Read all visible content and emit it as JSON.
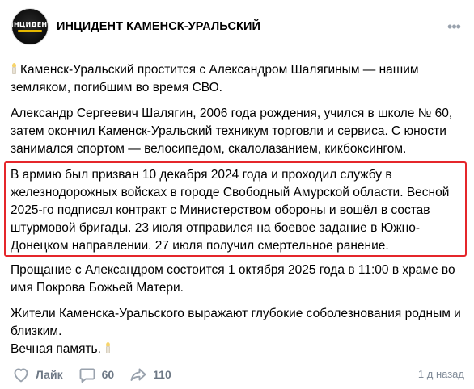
{
  "header": {
    "avatar_text": "ИНЦИДЕНТ",
    "title": "ИНЦИДЕНТ КАМЕНСК-УРАЛЬСКИЙ",
    "more_icon": "dots-horizontal-icon"
  },
  "post": {
    "p1": "Каменск-Уральский простится с Александром Шалягиным — нашим земляком, погибшим во время СВО.",
    "p2": "Александр Сергеевич Шалягин, 2006 года рождения, учился в школе № 60, затем окончил Каменск-Уральский техникум торговли и сервиса. С юности занимался спортом — велосипедом, скалолазанием, кикбоксингом.",
    "p3": "В армию был призван 10 декабря 2024 года и проходил службу в железнодорожных войсках в городе Свободный Амурской области. Весной 2025-го подписал контракт с Министерством обороны и вошёл в состав штурмовой бригады. 23 июля отправился на боевое задание в Южно-Донецком направлении. 27 июля получил смертельное ранение.",
    "p4": "Прощание с Александром состоится 1 октября 2025 года в 11:00 в храме во имя Покрова Божьей Матери.",
    "p5": "Жители Каменска-Уральского выражают глубокие соболезнования родным и близким.",
    "p6": "Вечная память."
  },
  "footer": {
    "like_label": "Лайк",
    "comments_count": "60",
    "shares_count": "110",
    "time": "1 д назад"
  },
  "colors": {
    "highlight_border": "#e5262b",
    "icon_gray": "#99a2ad",
    "secondary_text": "#6d7885"
  }
}
